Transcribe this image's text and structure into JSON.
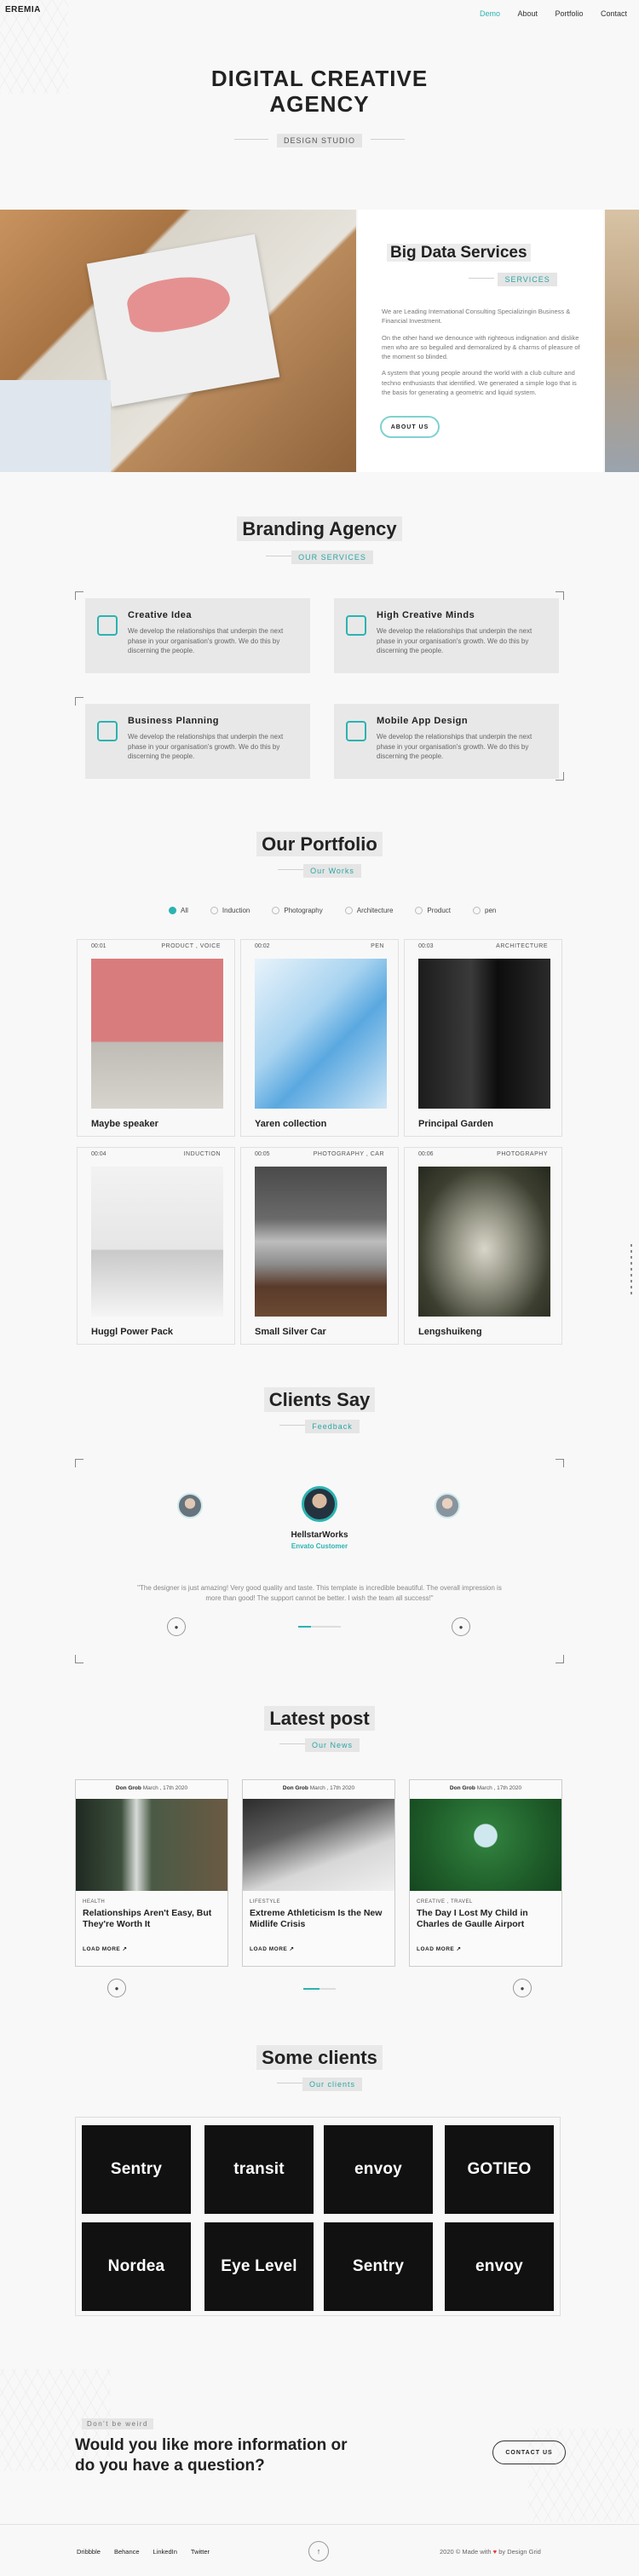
{
  "colors": {
    "accent": "#2bb3b1",
    "dark": "#111111",
    "bg": "#f8f8f8"
  },
  "nav": {
    "logo": "EREMIA",
    "items": [
      "Demo",
      "About",
      "Portfolio",
      "Contact"
    ],
    "active": "Demo"
  },
  "hero": {
    "title_line1": "DIGITAL CREATIVE",
    "title_line2": "AGENCY",
    "subtitle": "DESIGN STUDIO"
  },
  "bigdata": {
    "title": "Big Data Services",
    "tag": "SERVICES",
    "p1": "We are Leading International Consulting Specializingin Business & Financial Investment.",
    "p2": "On the other hand we denounce with righteous indignation and dislike men who are so beguiled and demoralized by & charms of pleasure of the moment so blinded.",
    "p3": "A system that young people around the world with a club culture and techno enthusiasts that identified. We generated a simple logo that is the basis for generating a geometric and liquid system.",
    "button": "ABOUT US"
  },
  "branding": {
    "title": "Branding Agency",
    "tag": "OUR SERVICES",
    "items": [
      {
        "title": "Creative Idea",
        "text": "We develop the relationships that underpin the next phase in your organisation's growth. We do this by discerning the people."
      },
      {
        "title": "High Creative Minds",
        "text": "We develop the relationships that underpin the next phase in your organisation's growth. We do this by discerning the people."
      },
      {
        "title": "Business Planning",
        "text": "We develop the relationships that underpin the next phase in your organisation's growth. We do this by discerning the people."
      },
      {
        "title": "Mobile App Design",
        "text": "We develop the relationships that underpin the next phase in your organisation's growth. We do this by discerning the people."
      }
    ]
  },
  "portfolio": {
    "title": "Our Portfolio",
    "tag": "Our Works",
    "filters": [
      "All",
      "Induction",
      "Photography",
      "Architecture",
      "Product",
      "pen"
    ],
    "items": [
      {
        "num": "00:01",
        "cat": "PRODUCT , VOICE",
        "title": "Maybe speaker"
      },
      {
        "num": "00:02",
        "cat": "PEN",
        "title": "Yaren collection"
      },
      {
        "num": "00:03",
        "cat": "ARCHITECTURE",
        "title": "Principal Garden"
      },
      {
        "num": "00:04",
        "cat": "INDUCTION",
        "title": "Huggl Power Pack"
      },
      {
        "num": "00:05",
        "cat": "PHOTOGRAPHY , CAR",
        "title": "Small Silver Car"
      },
      {
        "num": "00:06",
        "cat": "PHOTOGRAPHY",
        "title": "Lengshuikeng"
      }
    ]
  },
  "clients_say": {
    "title": "Clients Say",
    "tag": "Feedback",
    "name": "HellstarWorks",
    "role": "Envato Customer",
    "quote": "\"The designer is just amazing! Very good quality and taste. This template is incredible beautiful. The overall impression is more than good! The support cannot be better. I wish the team all success!\""
  },
  "posts": {
    "title": "Latest post",
    "tag": "Our News",
    "items": [
      {
        "author": "Don Grob",
        "date": "March , 17th 2020",
        "cat": "HEALTH",
        "title": "Relationships Aren't Easy, But They're Worth It",
        "more": "LOAD MORE"
      },
      {
        "author": "Don Grob",
        "date": "March , 17th 2020",
        "cat": "LIFESTYLE",
        "title": "Extreme Athleticism Is the New Midlife Crisis",
        "more": "LOAD MORE"
      },
      {
        "author": "Don Grob",
        "date": "March , 17th 2020",
        "cat": "CREATIVE , TRAVEL",
        "title": "The Day I Lost My Child in Charles de Gaulle Airport",
        "more": "LOAD MORE"
      }
    ]
  },
  "clients": {
    "title": "Some clients",
    "tag": "Our clients",
    "logos": [
      "Sentry",
      "transit",
      "envoy",
      "GOTIEO",
      "Nordea",
      "Eye Level",
      "Sentry",
      "envoy"
    ]
  },
  "cta": {
    "tag": "Don't be weird",
    "line1": "Would you like more information or",
    "line2": "do you have a question?",
    "button": "CONTACT US"
  },
  "footer": {
    "links": [
      "Dribbble",
      "Behance",
      "LinkedIn",
      "Twitter"
    ],
    "copy": "2020 © Made with",
    "by": "by Design Grid"
  }
}
